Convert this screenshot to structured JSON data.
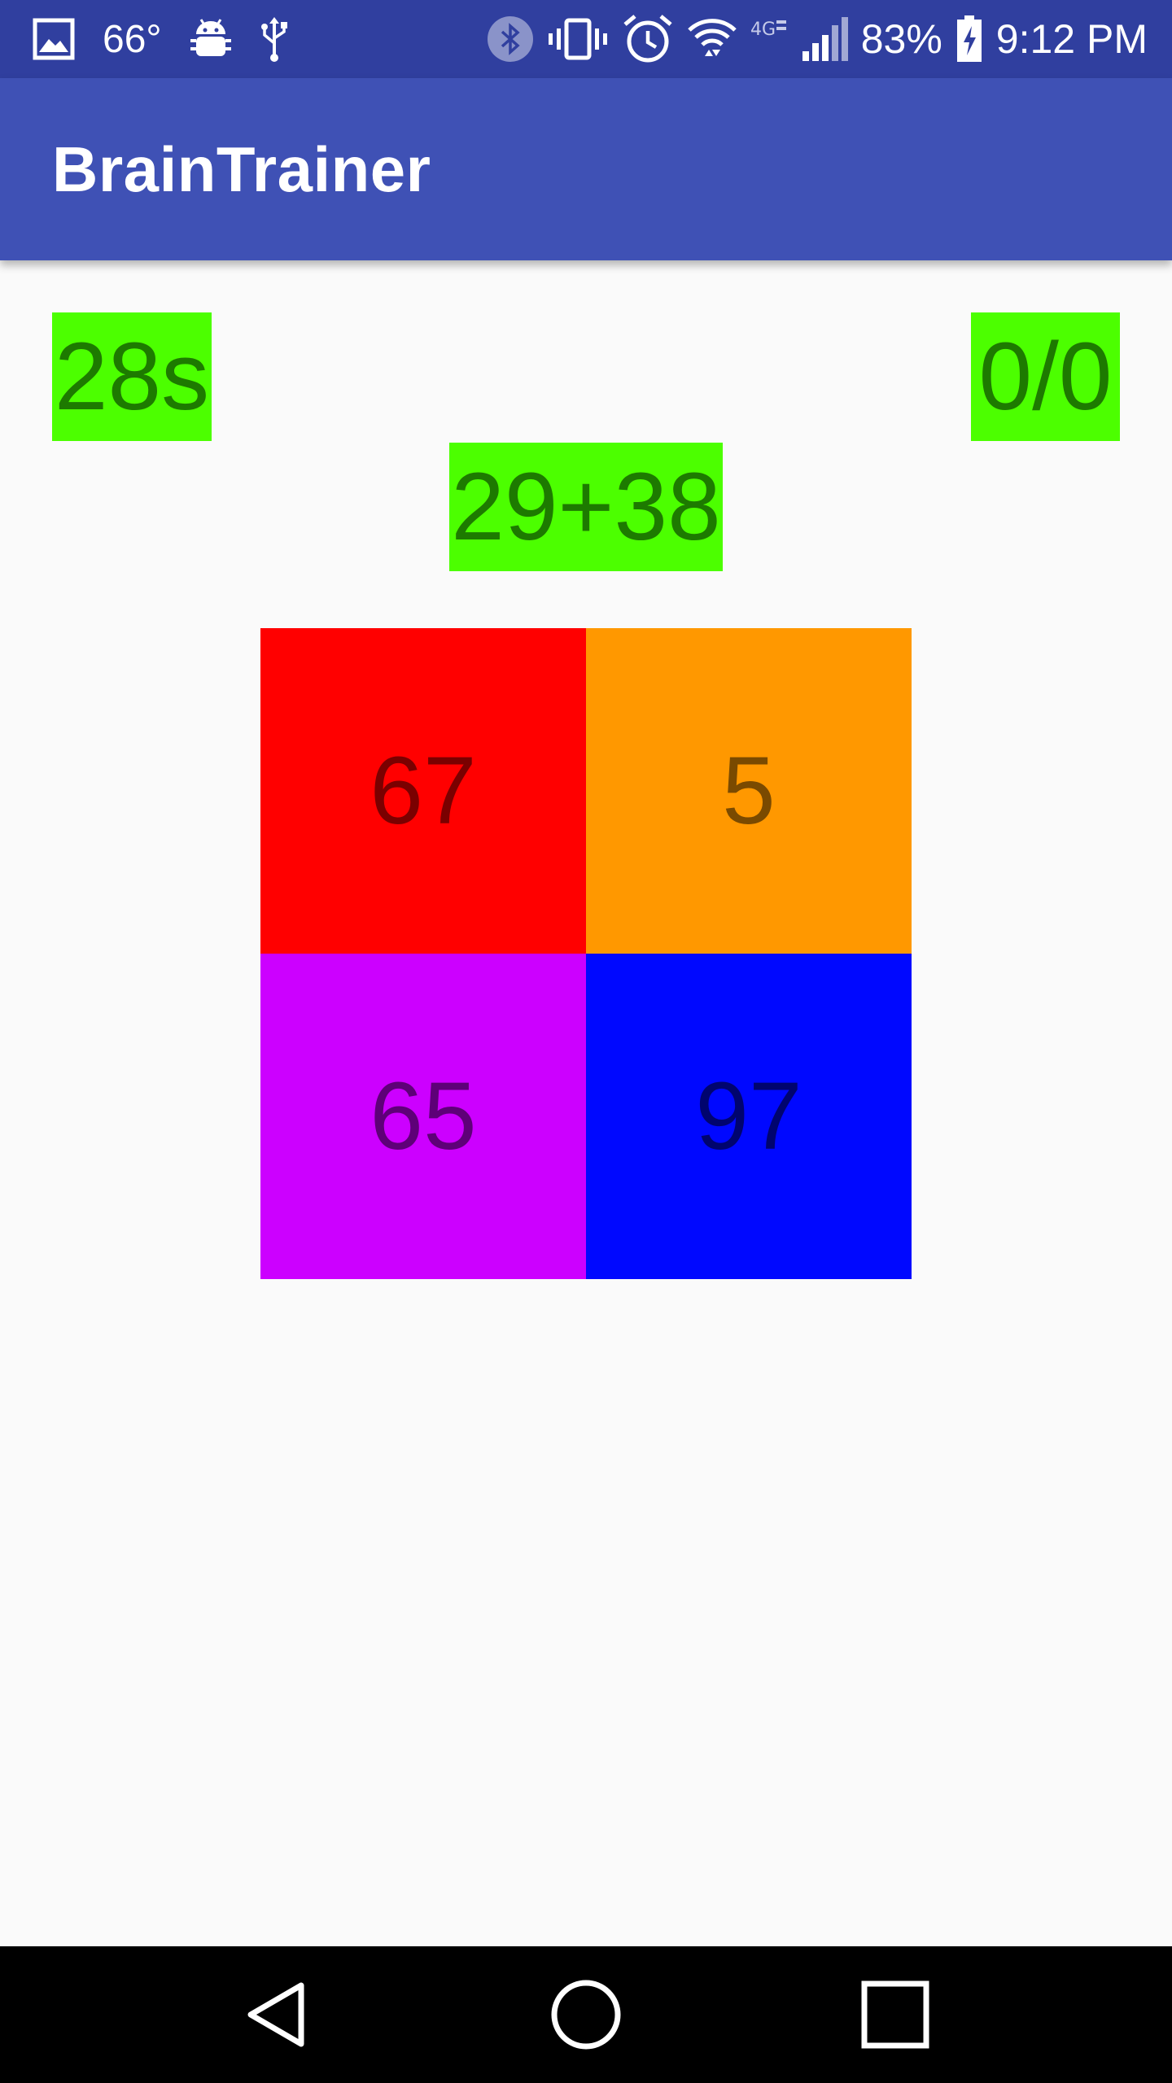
{
  "status_bar": {
    "temperature": "66°",
    "battery_percent": "83%",
    "time": "9:12 PM",
    "icons_left": [
      "gallery-icon",
      "android-debug-icon",
      "usb-icon"
    ],
    "icons_right": [
      "bluetooth-icon",
      "vibrate-icon",
      "alarm-icon",
      "wifi-icon",
      "lte-icon",
      "signal-icon",
      "battery-charging-icon"
    ]
  },
  "app_bar": {
    "title": "BrainTrainer"
  },
  "game": {
    "timer": "28s",
    "score": "0/0",
    "question": "29+38",
    "answers": [
      "67",
      "5",
      "65",
      "97"
    ],
    "label_color": "#4cff00",
    "answer_colors": [
      "#ff0000",
      "#ff9800",
      "#cc00ff",
      "#0008ff"
    ]
  },
  "nav_bar": {
    "buttons": [
      "back-icon",
      "home-icon",
      "recents-icon"
    ]
  },
  "colors": {
    "status_bar": "#303f9f",
    "app_bar": "#3f51b5",
    "background": "#fafafa"
  }
}
